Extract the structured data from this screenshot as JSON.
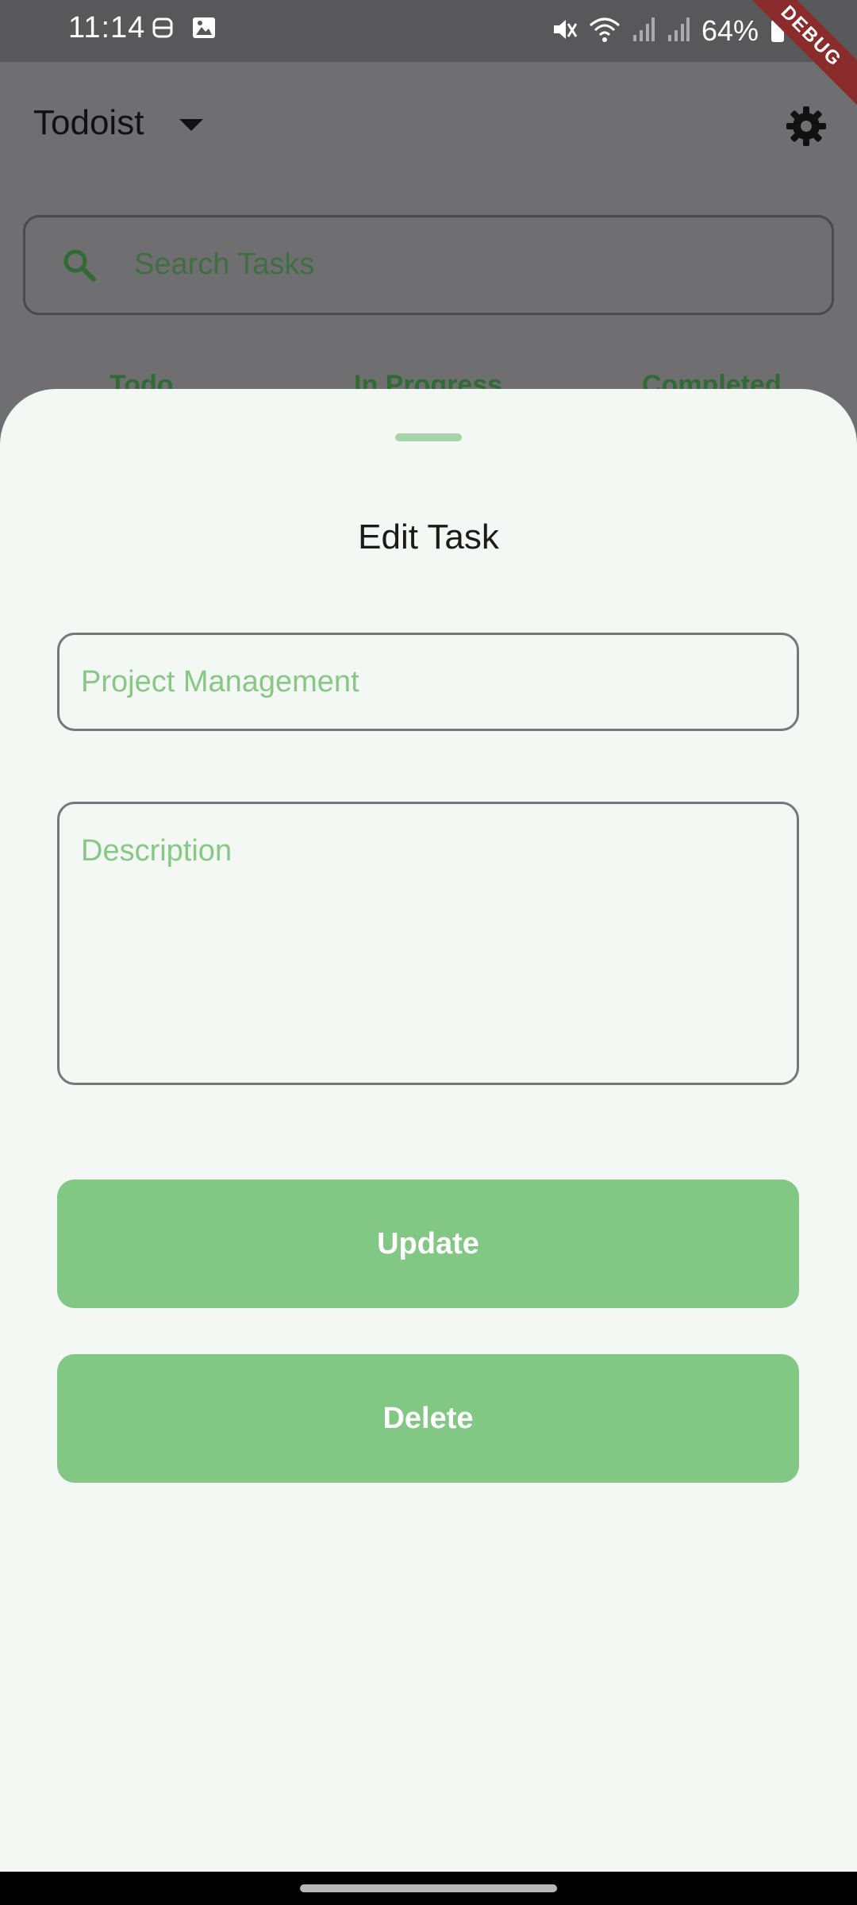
{
  "status_bar": {
    "time": "11:14",
    "battery_text": "64%",
    "debug_label": "DEBUG"
  },
  "app_bar": {
    "title": "Todoist"
  },
  "search": {
    "placeholder": "Search Tasks"
  },
  "tabs": [
    {
      "label": "Todo"
    },
    {
      "label": "In Progress"
    },
    {
      "label": "Completed"
    }
  ],
  "sheet": {
    "title": "Edit Task",
    "title_field_value": "Project Management",
    "description_placeholder": "Description",
    "update_label": "Update",
    "delete_label": "Delete"
  },
  "colors": {
    "accent": "#82c884",
    "sheet_background": "#f3f8f4",
    "scrim": "#6f6f71"
  }
}
